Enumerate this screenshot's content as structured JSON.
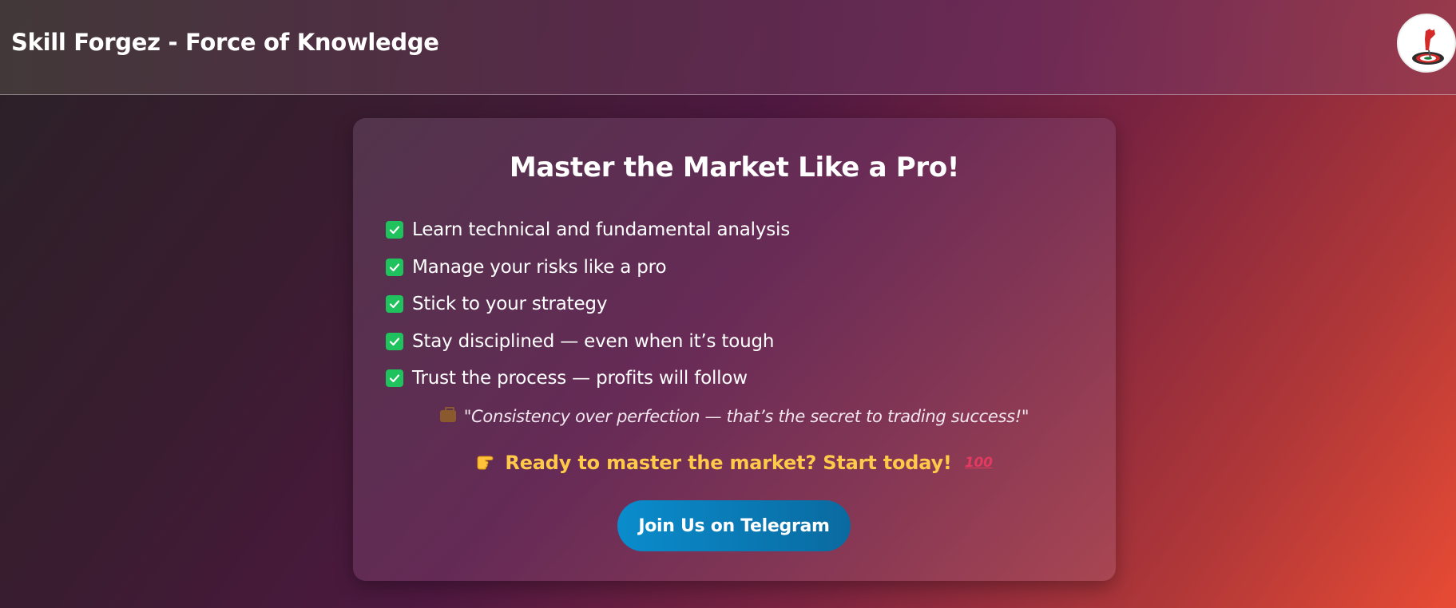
{
  "header": {
    "title": "Skill Forgez - Force of Knowledge",
    "logo_icon": "target-dart-logo"
  },
  "card": {
    "title": "Master the Market Like a Pro!",
    "features": [
      "Learn technical and fundamental analysis",
      "Manage your risks like a pro",
      "Stick to your strategy",
      "Stay disciplined — even when it’s tough",
      "Trust the process — profits will follow"
    ],
    "quote": "\"Consistency over perfection — that’s the secret to trading success!\"",
    "quote_icon": "briefcase-icon",
    "cta": "Ready to master the market? Start today!",
    "cta_icons": [
      "pointing-hand-icon",
      "hundred-points-icon"
    ],
    "button_label": "Join Us on Telegram"
  },
  "colors": {
    "check": "#1fc25c",
    "cta_text": "#ffc94a",
    "button": "#0a7ab8"
  }
}
